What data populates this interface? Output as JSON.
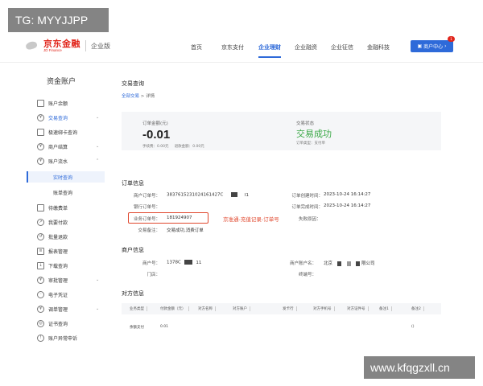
{
  "watermarks": {
    "top": "TG: MYYJJPP",
    "bottom": "www.kfqgzxll.cn"
  },
  "header": {
    "logo_cn": "京东金融",
    "logo_en": "JD Finance",
    "edition": "企业版",
    "nav": [
      "首页",
      "京东支付",
      "企业理财",
      "企业融资",
      "企业征信",
      "金融科技"
    ],
    "active_nav_index": 2,
    "account_button": "商户中心",
    "account_badge": "1"
  },
  "sidebar": {
    "title": "资金账户",
    "items": [
      {
        "label": "账户余额",
        "icon": "wallet-icon"
      },
      {
        "label": "交易查询",
        "icon": "yen-icon",
        "expanded": true
      },
      {
        "label": "极速绑卡查询",
        "icon": "card-icon"
      },
      {
        "label": "商户结算",
        "icon": "yen-icon",
        "expanded": true
      },
      {
        "label": "账户流水",
        "icon": "yen-icon",
        "expanded": true
      },
      {
        "label": "实时查询",
        "sub": true,
        "selected": true
      },
      {
        "label": "账单查询",
        "sub": true
      },
      {
        "label": "待缴费单",
        "icon": "bill-icon"
      },
      {
        "label": "我要付款",
        "icon": "pay-icon"
      },
      {
        "label": "批量退款",
        "icon": "refund-icon"
      },
      {
        "label": "报表管理",
        "icon": "report-icon"
      },
      {
        "label": "下载查询",
        "icon": "download-icon"
      },
      {
        "label": "审批管理",
        "icon": "yen-icon",
        "expanded": true
      },
      {
        "label": "电子凭证",
        "icon": "voucher-icon"
      },
      {
        "label": "调单管理",
        "icon": "yen-icon",
        "expanded": true
      },
      {
        "label": "证书查询",
        "icon": "cert-icon"
      },
      {
        "label": "账户异常申诉",
        "icon": "alert-icon"
      }
    ]
  },
  "main": {
    "title": "交易查询",
    "breadcrumb": {
      "parent": "全部交易",
      "sep": ">",
      "current": "详情"
    },
    "summary": {
      "amount_label": "订单金额(元)",
      "amount": "-0.01",
      "fee_label": "手续费：",
      "fee": "0.00元",
      "refund_label": "退款金额：",
      "refund": "0.00元",
      "status_label": "交易状态",
      "status": "交易成功",
      "order_type_label": "订单类型：",
      "order_type": "支付单"
    },
    "order_info": {
      "title": "订单信息",
      "merchant_order_label": "商户订单号：",
      "merchant_order": "3837615231024161427C",
      "merchant_order_tail": "I1",
      "create_time_label": "订单创建时间：",
      "create_time": "2023-10-24 16:14:27",
      "bank_order_label": "银行订单号：",
      "finish_time_label": "订单完成时间：",
      "finish_time": "2023-10-24 16:14:27",
      "business_order_label": "业务订单号：",
      "business_order": "181924907",
      "failure_label": "失败原因：",
      "remark_label": "交易备注：",
      "remark": "交易成功,消费订单",
      "annotation": "京准通-充值记录-订单号"
    },
    "merchant_info": {
      "title": "商户信息",
      "merchant_no_label": "商户号：",
      "merchant_no": "1378C",
      "merchant_no_tail": "11",
      "merchant_name_label": "商户账户名：",
      "merchant_name_prefix": "北京",
      "merchant_name_suffix": "限公司",
      "store_label": "门店：",
      "terminal_label": "终端号："
    },
    "counterparty": {
      "title": "对方信息",
      "columns": [
        "业务类型",
        "付款金额（元）",
        "对方名称",
        "对方账户",
        "发卡行",
        "对方手机号",
        "对方证件号",
        "备注1",
        "备注2"
      ],
      "row": {
        "type": "余额支付",
        "amount": "0.01",
        "remark2": "()"
      }
    }
  },
  "colors": {
    "brand_red": "#e1251b",
    "accent_blue": "#2e6ad9",
    "success_green": "#39a845",
    "annotation_red": "#e0472d"
  }
}
